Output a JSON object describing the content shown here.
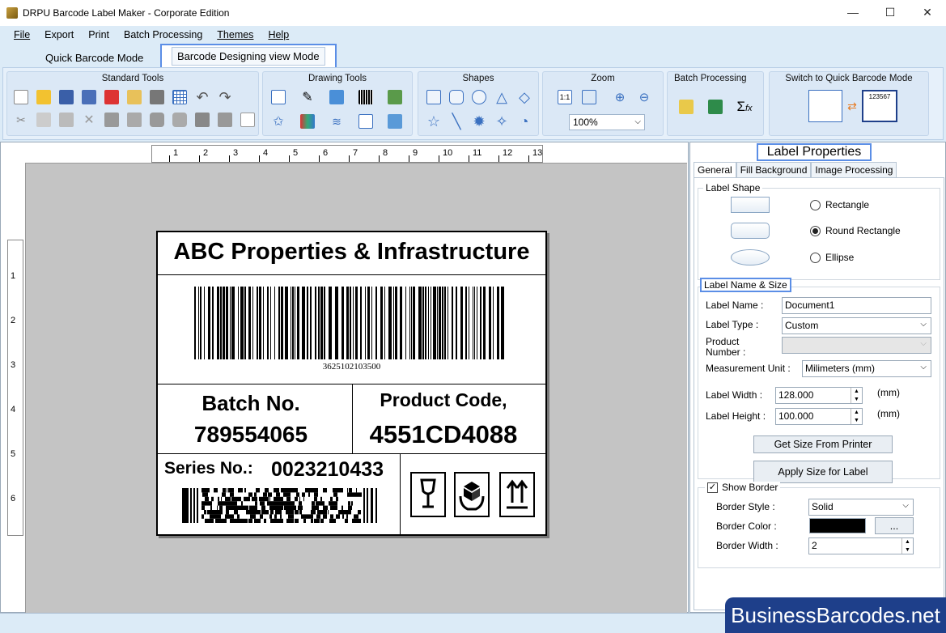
{
  "window": {
    "title": "DRPU Barcode Label Maker - Corporate Edition",
    "minimize": "—",
    "maximize": "☐",
    "close": "✕"
  },
  "menu": [
    "File",
    "Export",
    "Print",
    "Batch Processing",
    "Themes",
    "Help"
  ],
  "modes": {
    "quick": "Quick Barcode Mode",
    "design": "Barcode Designing view Mode"
  },
  "ribbon": {
    "standard_tools": "Standard Tools",
    "drawing_tools": "Drawing Tools",
    "shapes": "Shapes",
    "zoom": "Zoom",
    "zoom_value": "100%",
    "zoom_fit": "1:1",
    "batch_processing": "Batch Processing",
    "switch_mode": "Switch to Quick Barcode Mode",
    "switch_mode_preview": "123567"
  },
  "rulers": {
    "horizontal": [
      "1",
      "2",
      "3",
      "4",
      "5",
      "6",
      "7",
      "8",
      "9",
      "10",
      "11",
      "12",
      "13"
    ],
    "vertical": [
      "1",
      "2",
      "3",
      "4",
      "5",
      "6"
    ]
  },
  "label": {
    "title": "ABC Properties & Infrastructure",
    "barcode_number": "3625102103500",
    "batch_label": "Batch No.",
    "batch_value": "789554065",
    "product_label": "Product Code,",
    "product_value": "4551CD4088",
    "series_label": "Series No.:",
    "series_value": "0023210433"
  },
  "properties": {
    "title": "Label Properties",
    "tabs": [
      "General",
      "Fill Background",
      "Image Processing"
    ],
    "label_shape": "Label Shape",
    "shapes": [
      "Rectangle",
      "Round Rectangle",
      "Ellipse"
    ],
    "selected_shape": "Round Rectangle",
    "name_size": "Label  Name & Size",
    "label_name_lbl": "Label Name :",
    "label_name": "Document1",
    "label_type_lbl": "Label Type :",
    "label_type": "Custom",
    "product_number_lbl": "Product Number :",
    "measurement_lbl": "Measurement Unit :",
    "measurement": "Milimeters (mm)",
    "width_lbl": "Label Width :",
    "width": "128.000",
    "height_lbl": "Label Height :",
    "height": "100.000",
    "unit": "(mm)",
    "get_size_btn": "Get Size From Printer",
    "apply_size_btn": "Apply Size for Label",
    "show_border": "Show Border",
    "show_border_checked": true,
    "border_style_lbl": "Border Style :",
    "border_style": "Solid",
    "border_color_lbl": "Border Color :",
    "border_color": "#000000",
    "border_color_btn": "...",
    "border_width_lbl": "Border Width :",
    "border_width": "2"
  },
  "watermark": "BusinessBarcodes.net",
  "colors": {
    "accent": "#5b8ee6",
    "ribbon_bg": "#dcebf7",
    "watermark_bg": "#1e3f8a"
  }
}
